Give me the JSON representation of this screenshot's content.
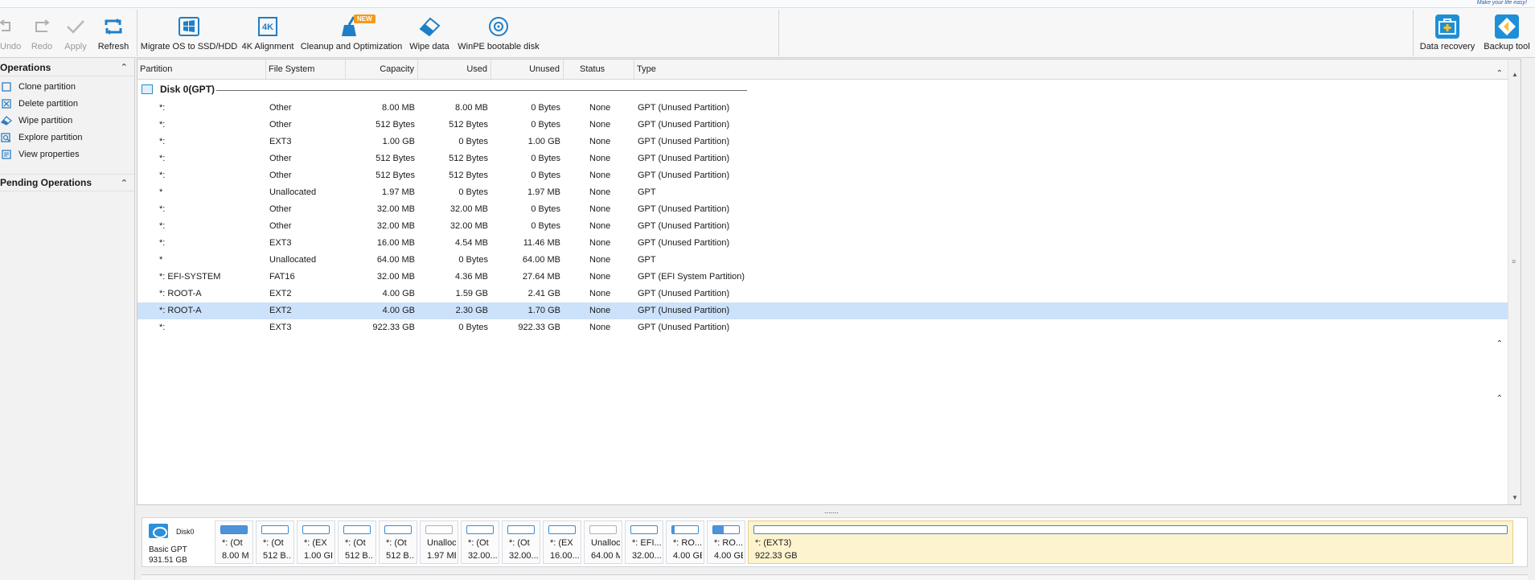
{
  "tagline": "Make your life easy!",
  "toolbar": {
    "undo": "Undo",
    "redo": "Redo",
    "apply": "Apply",
    "refresh": "Refresh",
    "migrate": "Migrate OS to SSD/HDD",
    "alignment": "4K Alignment",
    "cleanup": "Cleanup and Optimization",
    "new_badge": "NEW",
    "wipe": "Wipe data",
    "winpe": "WinPE bootable disk",
    "recovery": "Data recovery",
    "backup": "Backup tool",
    "alignment_icon_text": "4K"
  },
  "sidebar": {
    "operations_title": "Operations",
    "operations": [
      {
        "label": "Clone partition",
        "icon": "clone-icon"
      },
      {
        "label": "Delete partition",
        "icon": "delete-icon"
      },
      {
        "label": "Wipe partition",
        "icon": "eraser-icon"
      },
      {
        "label": "Explore partition",
        "icon": "explore-icon"
      },
      {
        "label": "View properties",
        "icon": "properties-icon"
      }
    ],
    "pending_title": "Pending Operations"
  },
  "table": {
    "headers": [
      "Partition",
      "File System",
      "Capacity",
      "Used",
      "Unused",
      "Status",
      "Type"
    ],
    "disk_label": "Disk 0(GPT)",
    "rows": [
      {
        "partition": "*:",
        "fs": "Other",
        "capacity": "8.00 MB",
        "used": "8.00 MB",
        "unused": "0 Bytes",
        "status": "None",
        "type": "GPT (Unused Partition)"
      },
      {
        "partition": "*:",
        "fs": "Other",
        "capacity": "512 Bytes",
        "used": "512 Bytes",
        "unused": "0 Bytes",
        "status": "None",
        "type": "GPT (Unused Partition)"
      },
      {
        "partition": "*:",
        "fs": "EXT3",
        "capacity": "1.00 GB",
        "used": "0 Bytes",
        "unused": "1.00 GB",
        "status": "None",
        "type": "GPT (Unused Partition)"
      },
      {
        "partition": "*:",
        "fs": "Other",
        "capacity": "512 Bytes",
        "used": "512 Bytes",
        "unused": "0 Bytes",
        "status": "None",
        "type": "GPT (Unused Partition)"
      },
      {
        "partition": "*:",
        "fs": "Other",
        "capacity": "512 Bytes",
        "used": "512 Bytes",
        "unused": "0 Bytes",
        "status": "None",
        "type": "GPT (Unused Partition)"
      },
      {
        "partition": "*",
        "fs": "Unallocated",
        "capacity": "1.97 MB",
        "used": "0 Bytes",
        "unused": "1.97 MB",
        "status": "None",
        "type": "GPT"
      },
      {
        "partition": "*:",
        "fs": "Other",
        "capacity": "32.00 MB",
        "used": "32.00 MB",
        "unused": "0 Bytes",
        "status": "None",
        "type": "GPT (Unused Partition)"
      },
      {
        "partition": "*:",
        "fs": "Other",
        "capacity": "32.00 MB",
        "used": "32.00 MB",
        "unused": "0 Bytes",
        "status": "None",
        "type": "GPT (Unused Partition)"
      },
      {
        "partition": "*:",
        "fs": "EXT3",
        "capacity": "16.00 MB",
        "used": "4.54 MB",
        "unused": "11.46 MB",
        "status": "None",
        "type": "GPT (Unused Partition)"
      },
      {
        "partition": "*",
        "fs": "Unallocated",
        "capacity": "64.00 MB",
        "used": "0 Bytes",
        "unused": "64.00 MB",
        "status": "None",
        "type": "GPT"
      },
      {
        "partition": "*: EFI-SYSTEM",
        "fs": "FAT16",
        "capacity": "32.00 MB",
        "used": "4.36 MB",
        "unused": "27.64 MB",
        "status": "None",
        "type": "GPT (EFI System Partition)"
      },
      {
        "partition": "*: ROOT-A",
        "fs": "EXT2",
        "capacity": "4.00 GB",
        "used": "1.59 GB",
        "unused": "2.41 GB",
        "status": "None",
        "type": "GPT (Unused Partition)"
      },
      {
        "partition": "*: ROOT-A",
        "fs": "EXT2",
        "capacity": "4.00 GB",
        "used": "2.30 GB",
        "unused": "1.70 GB",
        "status": "None",
        "type": "GPT (Unused Partition)",
        "selected": true
      },
      {
        "partition": "*:",
        "fs": "EXT3",
        "capacity": "922.33 GB",
        "used": "0 Bytes",
        "unused": "922.33 GB",
        "status": "None",
        "type": "GPT (Unused Partition)"
      }
    ]
  },
  "diskmap": {
    "disk_name": "Disk0",
    "disk_type": "Basic GPT",
    "disk_size": "931.51 GB",
    "blocks": [
      {
        "label": "*: (Ot",
        "size": "8.00 M",
        "fill": 1.0
      },
      {
        "label": "*: (Ot",
        "size": "512 B...",
        "fill": 0.0
      },
      {
        "label": "*: (EX",
        "size": "1.00 GI",
        "fill": 0.0
      },
      {
        "label": "*: (Ot",
        "size": "512 B...",
        "fill": 0.0
      },
      {
        "label": "*: (Ot",
        "size": "512 B...",
        "fill": 0.0
      },
      {
        "label": "Unalloc...",
        "size": "1.97 MB",
        "fill": 0.0,
        "unalloc": true
      },
      {
        "label": "*: (Ot",
        "size": "32.00...",
        "fill": 0.0
      },
      {
        "label": "*: (Ot",
        "size": "32.00...",
        "fill": 0.0
      },
      {
        "label": "*: (EX",
        "size": "16.00...",
        "fill": 0.0
      },
      {
        "label": "Unalloc...",
        "size": "64.00 MI",
        "fill": 0.0,
        "unalloc": true
      },
      {
        "label": "*: EFI...",
        "size": "32.00...",
        "fill": 0.0
      },
      {
        "label": "*: RO...",
        "size": "4.00 GE",
        "fill": 0.1
      },
      {
        "label": "*: RO...",
        "size": "4.00 GE",
        "fill": 0.4
      },
      {
        "label": "*: (EXT3)",
        "size": "922.33 GB",
        "fill": 0.0,
        "big": true
      }
    ]
  },
  "grip": "......."
}
